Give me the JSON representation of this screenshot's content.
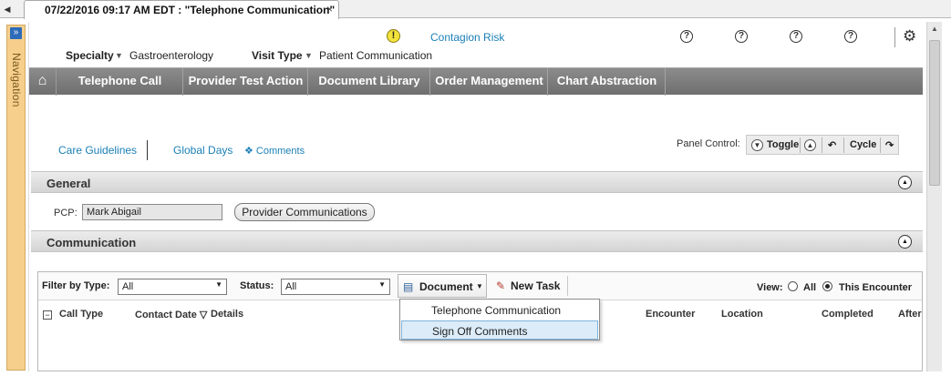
{
  "tab": {
    "title": "07/22/2016 09:17 AM EDT : \"Telephone Communication\"",
    "close": "×",
    "back": "◀"
  },
  "navigation": {
    "label": "Navigation",
    "expand": "»"
  },
  "header": {
    "contagion_icon": "!",
    "contagion_label": "Contagion Risk",
    "help_glyph": "?",
    "gear_glyph": "⚙",
    "specialty_label": "Specialty",
    "specialty_value": "Gastroenterology",
    "visit_type_label": "Visit Type",
    "visit_type_value": "Patient Communication",
    "dropdown_glyph": "▼"
  },
  "toolbar": {
    "home_glyph": "⌂",
    "buttons": [
      "Telephone Call",
      "Provider Test Action",
      "Document Library",
      "Order Management",
      "Chart Abstraction"
    ]
  },
  "links": {
    "care_guidelines": "Care Guidelines",
    "global_days": "Global Days",
    "comments": "❖ Comments"
  },
  "panel_control": {
    "label": "Panel Control:",
    "toggle": "Toggle",
    "cycle": "Cycle"
  },
  "general": {
    "title": "General",
    "pcp_label": "PCP:",
    "pcp_value": "Mark Abigail",
    "provider_comm_button": "Provider Communications"
  },
  "communication": {
    "title": "Communication",
    "filter_label": "Filter by Type:",
    "filter_value": "All",
    "status_label": "Status:",
    "status_value": "All",
    "document_button": "Document",
    "new_task_button": "New Task",
    "view_label": "View:",
    "view_options": [
      "All",
      "This Encounter"
    ],
    "view_selected": "This Encounter",
    "columns": [
      "Call Type",
      "Contact Date ▽",
      "Details",
      "Encounter",
      "Location",
      "Completed",
      "After"
    ]
  },
  "document_menu": {
    "items": [
      "Telephone Communication",
      "Sign Off Comments"
    ],
    "highlighted": "Sign Off Comments"
  }
}
